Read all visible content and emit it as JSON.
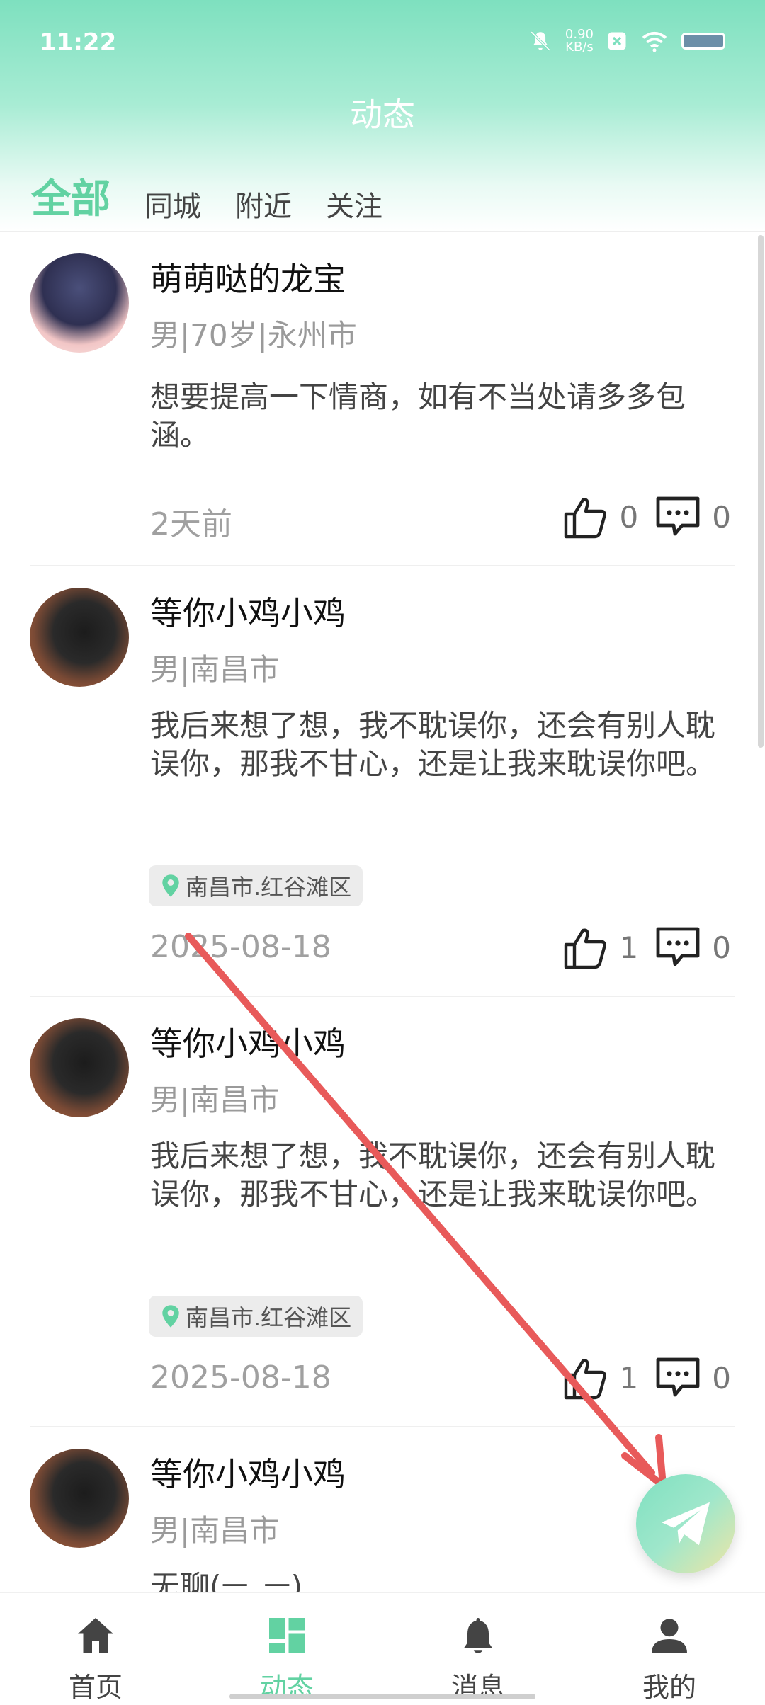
{
  "status": {
    "time": "11:22",
    "speed": "0.90",
    "speed_unit": "KB/s"
  },
  "header": {
    "title": "动态"
  },
  "tabs": [
    {
      "label": "全部",
      "active": true
    },
    {
      "label": "同城"
    },
    {
      "label": "附近"
    },
    {
      "label": "关注"
    }
  ],
  "posts": [
    {
      "name": "萌萌哒的龙宝",
      "meta": "男|70岁|永州市",
      "content": "想要提高一下情商，如有不当处请多多包涵。",
      "time": "2天前",
      "likes": "0",
      "comments": "0"
    },
    {
      "name": "等你小鸡小鸡",
      "meta": "男|南昌市",
      "content": "我后来想了想，我不耽误你，还会有别人耽误你，那我不甘心，还是让我来耽误你吧。",
      "location": "南昌市.红谷滩区",
      "time": "2025-08-18",
      "likes": "1",
      "comments": "0"
    },
    {
      "name": "等你小鸡小鸡",
      "meta": "男|南昌市",
      "content": "我后来想了想，我不耽误你，还会有别人耽误你，那我不甘心，还是让我来耽误你吧。",
      "location": "南昌市.红谷滩区",
      "time": "2025-08-18",
      "likes": "1",
      "comments": "0"
    },
    {
      "name": "等你小鸡小鸡",
      "meta": "男|南昌市",
      "content": "无聊(ㅡ_ㅡ)"
    }
  ],
  "nav": [
    {
      "label": "首页",
      "icon": "home-icon"
    },
    {
      "label": "动态",
      "icon": "grid-icon",
      "active": true
    },
    {
      "label": "消息",
      "icon": "bell-icon"
    },
    {
      "label": "我的",
      "icon": "person-icon"
    }
  ],
  "colors": {
    "accent": "#62d2a2",
    "annotation": "#e85a5a"
  }
}
